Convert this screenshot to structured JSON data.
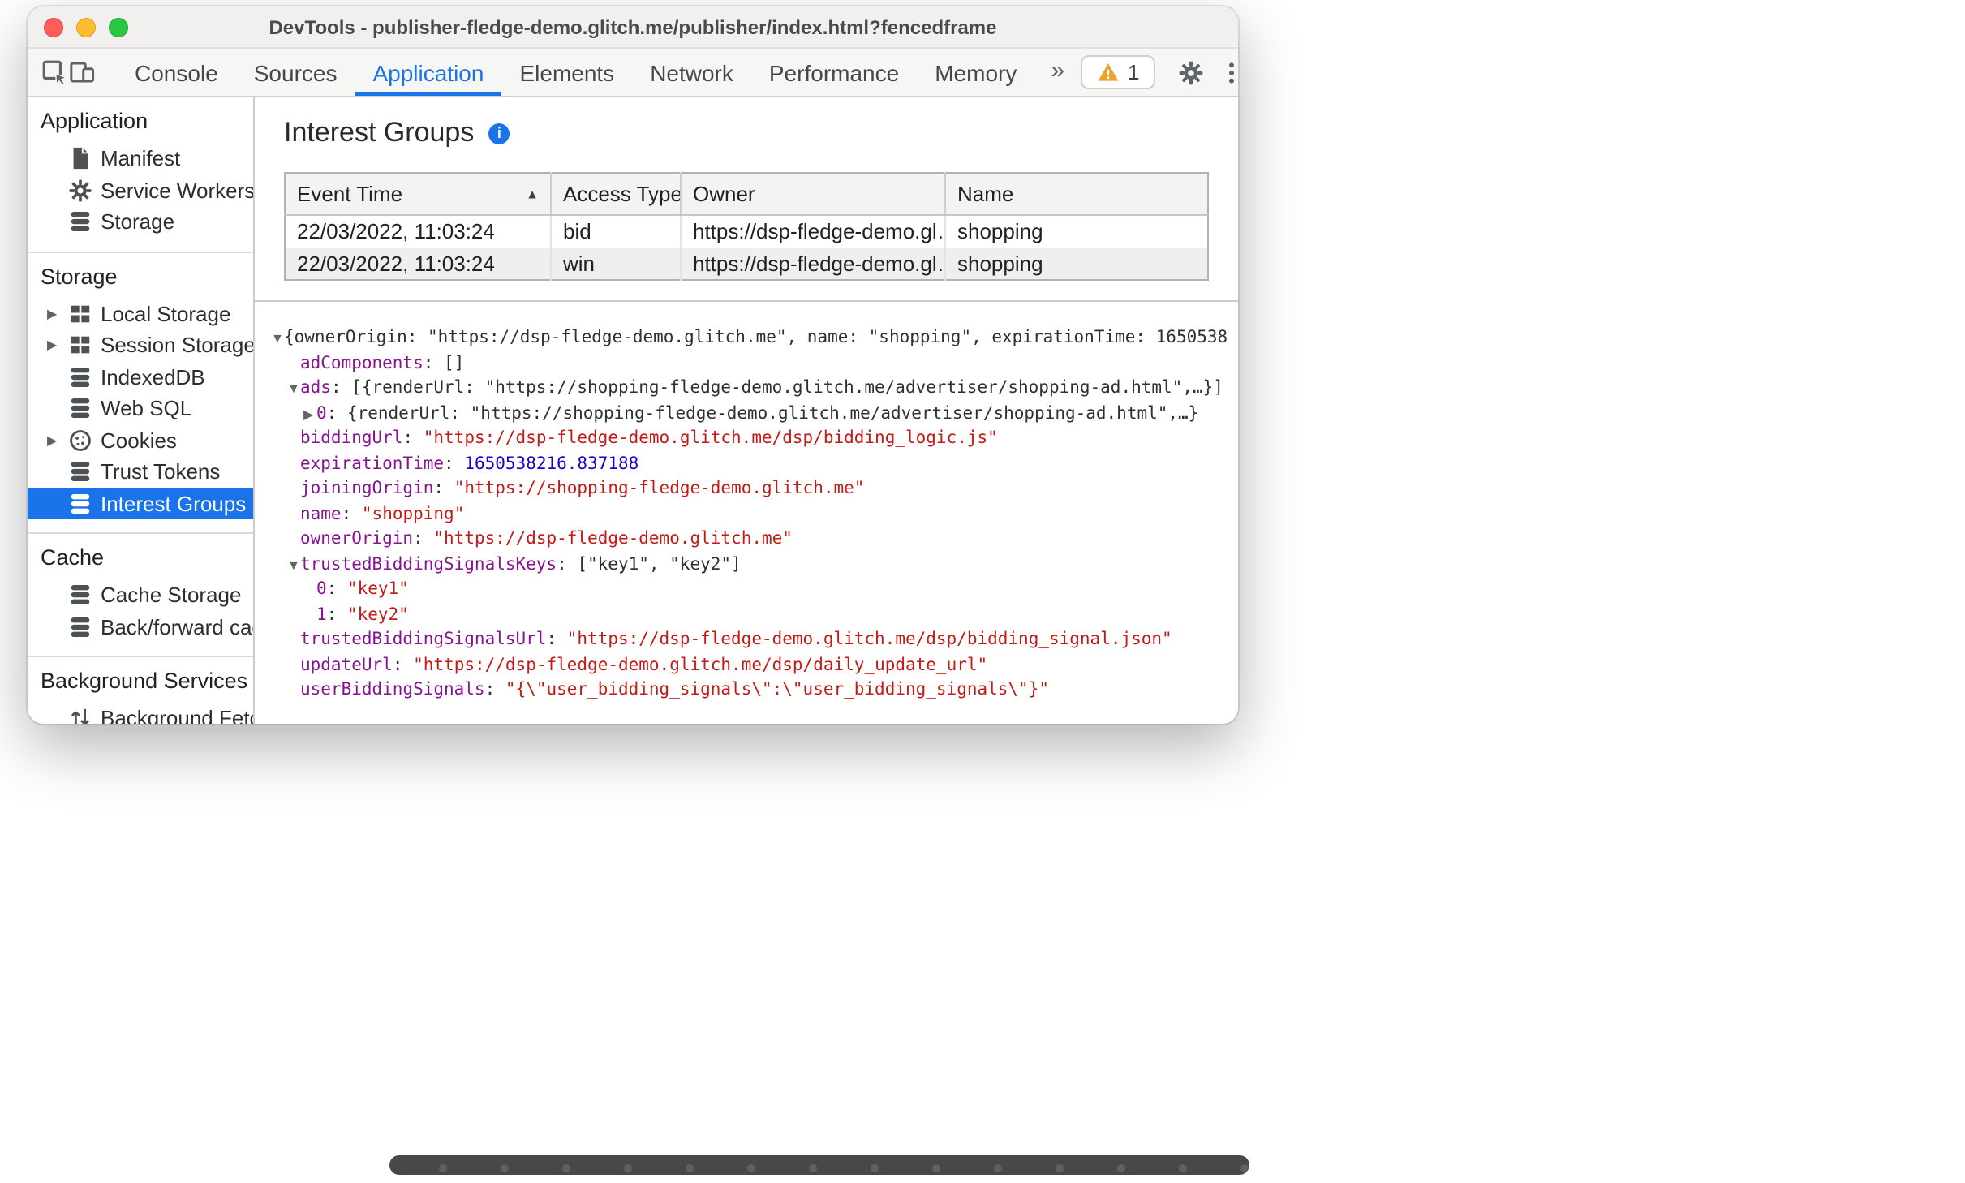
{
  "colors": {
    "accent": "#1a73e8",
    "warning": "#eda12e",
    "key_purple": "#881391",
    "string_red": "#c41a16",
    "number_blue": "#1c00cf"
  },
  "window": {
    "title": "DevTools - publisher-fledge-demo.glitch.me/publisher/index.html?fencedframe"
  },
  "toolbar": {
    "icons": [
      "inspect-icon",
      "device-toolbar-icon",
      "settings-gear-icon",
      "more-options-kebab-icon"
    ],
    "tabs": [
      {
        "label": "Console",
        "selected": false
      },
      {
        "label": "Sources",
        "selected": false
      },
      {
        "label": "Application",
        "selected": true
      },
      {
        "label": "Elements",
        "selected": false
      },
      {
        "label": "Network",
        "selected": false
      },
      {
        "label": "Performance",
        "selected": false
      },
      {
        "label": "Memory",
        "selected": false
      }
    ],
    "overflow_chevron": "»",
    "warning_badge": {
      "count": "1"
    }
  },
  "sidebar": {
    "sections": [
      {
        "title": "Application",
        "items": [
          {
            "label": "Manifest",
            "icon": "manifest-file-icon",
            "expandable": false,
            "selected": false
          },
          {
            "label": "Service Workers",
            "icon": "gear-icon",
            "expandable": false,
            "selected": false
          },
          {
            "label": "Storage",
            "icon": "database-icon",
            "expandable": false,
            "selected": false
          }
        ]
      },
      {
        "title": "Storage",
        "items": [
          {
            "label": "Local Storage",
            "icon": "table-grid-icon",
            "expandable": true,
            "selected": false
          },
          {
            "label": "Session Storage",
            "icon": "table-grid-icon",
            "expandable": true,
            "selected": false
          },
          {
            "label": "IndexedDB",
            "icon": "database-icon",
            "expandable": false,
            "selected": false
          },
          {
            "label": "Web SQL",
            "icon": "database-icon",
            "expandable": false,
            "selected": false
          },
          {
            "label": "Cookies",
            "icon": "cookie-icon",
            "expandable": true,
            "selected": false
          },
          {
            "label": "Trust Tokens",
            "icon": "database-icon",
            "expandable": false,
            "selected": false
          },
          {
            "label": "Interest Groups",
            "icon": "database-icon",
            "expandable": false,
            "selected": true
          }
        ]
      },
      {
        "title": "Cache",
        "items": [
          {
            "label": "Cache Storage",
            "icon": "database-icon",
            "expandable": false,
            "selected": false
          },
          {
            "label": "Back/forward cach",
            "icon": "database-icon",
            "expandable": false,
            "selected": false
          }
        ]
      },
      {
        "title": "Background Services",
        "items": [
          {
            "label": "Background Fetch",
            "icon": "fetch-arrows-icon",
            "expandable": false,
            "selected": false
          }
        ]
      }
    ]
  },
  "main": {
    "title": "Interest Groups",
    "table": {
      "columns": [
        {
          "label": "Event Time",
          "sorted": true
        },
        {
          "label": "Access Type",
          "sorted": false
        },
        {
          "label": "Owner",
          "sorted": false
        },
        {
          "label": "Name",
          "sorted": false
        }
      ],
      "rows": [
        {
          "event_time": "22/03/2022, 11:03:24",
          "access_type": "bid",
          "owner": "https://dsp-fledge-demo.gl…",
          "name": "shopping"
        },
        {
          "event_time": "22/03/2022, 11:03:24",
          "access_type": "win",
          "owner": "https://dsp-fledge-demo.gl…",
          "name": "shopping"
        }
      ]
    },
    "tree": [
      {
        "indent": 0,
        "arrow": "expanded",
        "tokens": [
          {
            "type": "plain",
            "text": "{ownerOrigin: \"https://dsp-fledge-demo.glitch.me\", name: \"shopping\", expirationTime: 1650538"
          }
        ]
      },
      {
        "indent": 1,
        "arrow": "none",
        "tokens": [
          {
            "type": "key",
            "text": "adComponents"
          },
          {
            "type": "plain",
            "text": ": []"
          }
        ]
      },
      {
        "indent": 1,
        "arrow": "expanded",
        "tokens": [
          {
            "type": "key",
            "text": "ads"
          },
          {
            "type": "plain",
            "text": ": [{renderUrl: \"https://shopping-fledge-demo.glitch.me/advertiser/shopping-ad.html\",…}]"
          }
        ]
      },
      {
        "indent": 2,
        "arrow": "collapsed",
        "tokens": [
          {
            "type": "key",
            "text": "0"
          },
          {
            "type": "plain",
            "text": ": {renderUrl: \"https://shopping-fledge-demo.glitch.me/advertiser/shopping-ad.html\",…}"
          }
        ]
      },
      {
        "indent": 1,
        "arrow": "none",
        "tokens": [
          {
            "type": "key",
            "text": "biddingUrl"
          },
          {
            "type": "plain",
            "text": ": "
          },
          {
            "type": "string",
            "text": "\"https://dsp-fledge-demo.glitch.me/dsp/bidding_logic.js\""
          }
        ]
      },
      {
        "indent": 1,
        "arrow": "none",
        "tokens": [
          {
            "type": "key",
            "text": "expirationTime"
          },
          {
            "type": "plain",
            "text": ": "
          },
          {
            "type": "number",
            "text": "1650538216.837188"
          }
        ]
      },
      {
        "indent": 1,
        "arrow": "none",
        "tokens": [
          {
            "type": "key",
            "text": "joiningOrigin"
          },
          {
            "type": "plain",
            "text": ": "
          },
          {
            "type": "string",
            "text": "\"https://shopping-fledge-demo.glitch.me\""
          }
        ]
      },
      {
        "indent": 1,
        "arrow": "none",
        "tokens": [
          {
            "type": "key",
            "text": "name"
          },
          {
            "type": "plain",
            "text": ": "
          },
          {
            "type": "string",
            "text": "\"shopping\""
          }
        ]
      },
      {
        "indent": 1,
        "arrow": "none",
        "tokens": [
          {
            "type": "key",
            "text": "ownerOrigin"
          },
          {
            "type": "plain",
            "text": ": "
          },
          {
            "type": "string",
            "text": "\"https://dsp-fledge-demo.glitch.me\""
          }
        ]
      },
      {
        "indent": 1,
        "arrow": "expanded",
        "tokens": [
          {
            "type": "key",
            "text": "trustedBiddingSignalsKeys"
          },
          {
            "type": "plain",
            "text": ": [\"key1\", \"key2\"]"
          }
        ]
      },
      {
        "indent": 2,
        "arrow": "none",
        "tokens": [
          {
            "type": "key",
            "text": "0"
          },
          {
            "type": "plain",
            "text": ": "
          },
          {
            "type": "string",
            "text": "\"key1\""
          }
        ]
      },
      {
        "indent": 2,
        "arrow": "none",
        "tokens": [
          {
            "type": "key",
            "text": "1"
          },
          {
            "type": "plain",
            "text": ": "
          },
          {
            "type": "string",
            "text": "\"key2\""
          }
        ]
      },
      {
        "indent": 1,
        "arrow": "none",
        "tokens": [
          {
            "type": "key",
            "text": "trustedBiddingSignalsUrl"
          },
          {
            "type": "plain",
            "text": ": "
          },
          {
            "type": "string",
            "text": "\"https://dsp-fledge-demo.glitch.me/dsp/bidding_signal.json\""
          }
        ]
      },
      {
        "indent": 1,
        "arrow": "none",
        "tokens": [
          {
            "type": "key",
            "text": "updateUrl"
          },
          {
            "type": "plain",
            "text": ": "
          },
          {
            "type": "string",
            "text": "\"https://dsp-fledge-demo.glitch.me/dsp/daily_update_url\""
          }
        ]
      },
      {
        "indent": 1,
        "arrow": "none",
        "tokens": [
          {
            "type": "key",
            "text": "userBiddingSignals"
          },
          {
            "type": "plain",
            "text": ": "
          },
          {
            "type": "string",
            "text": "\"{\\\"user_bidding_signals\\\":\\\"user_bidding_signals\\\"}\""
          }
        ]
      }
    ]
  }
}
